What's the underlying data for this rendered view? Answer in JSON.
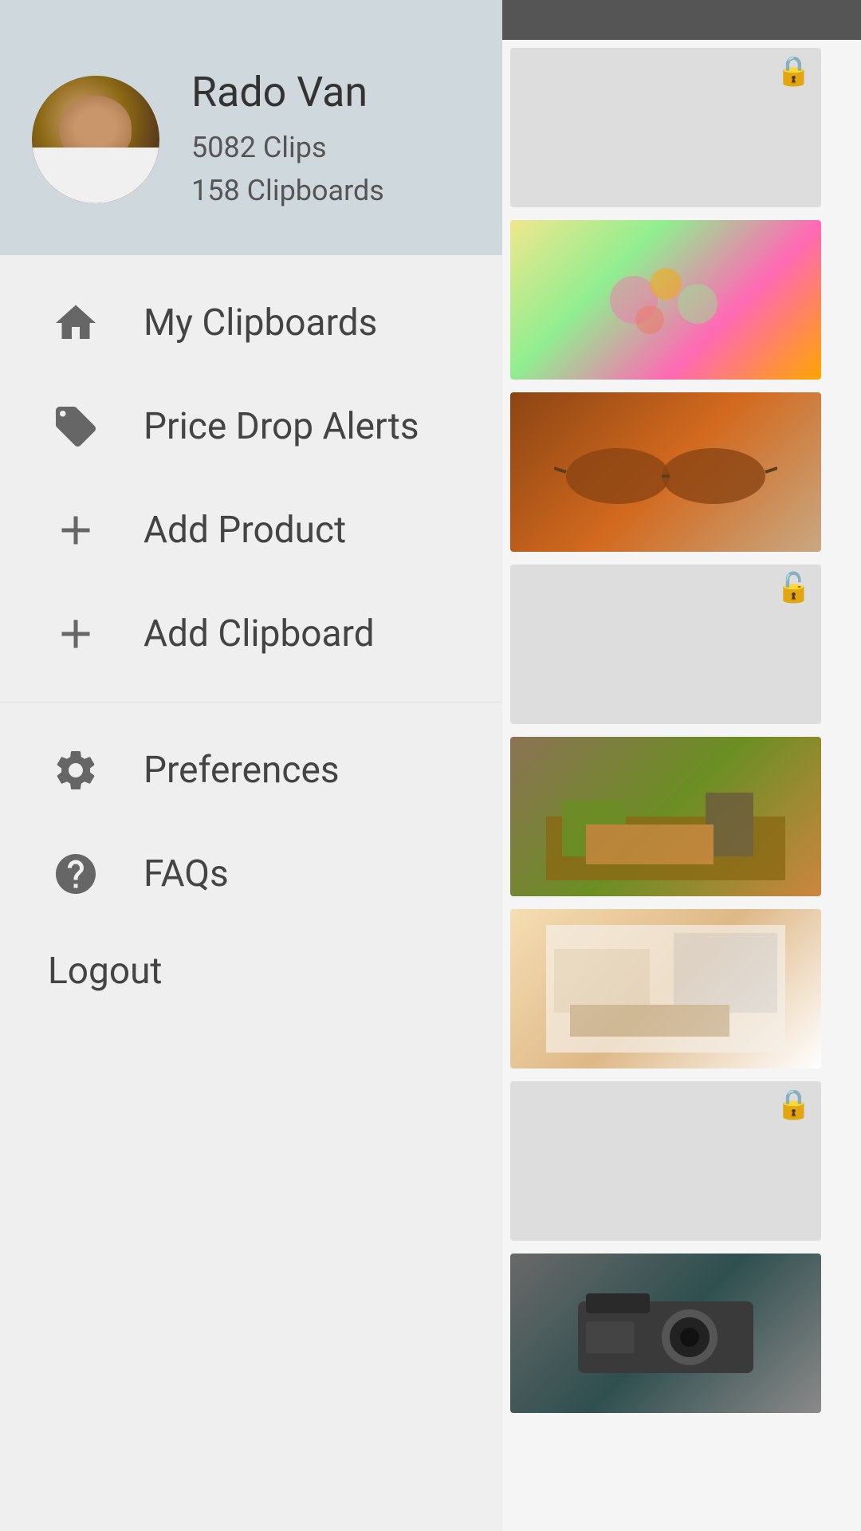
{
  "statusBar": {
    "height": 50
  },
  "header": {
    "chatIconLabel": "chat"
  },
  "profile": {
    "name": "Rado Van",
    "clips": "5082 Clips",
    "clipboards": "158 Clipboards"
  },
  "menu": {
    "topItems": [
      {
        "id": "my-clipboards",
        "label": "My Clipboards",
        "icon": "home"
      },
      {
        "id": "price-drop-alerts",
        "label": "Price Drop Alerts",
        "icon": "pricetag"
      },
      {
        "id": "add-product",
        "label": "Add Product",
        "icon": "plus"
      },
      {
        "id": "add-clipboard",
        "label": "Add Clipboard",
        "icon": "plus"
      }
    ],
    "bottomItems": [
      {
        "id": "preferences",
        "label": "Preferences",
        "icon": "gear"
      },
      {
        "id": "faqs",
        "label": "FAQs",
        "icon": "question"
      }
    ],
    "logoutLabel": "Logout"
  },
  "rightGrid": {
    "items": [
      {
        "id": "item1",
        "locked": false,
        "thumbType": "empty"
      },
      {
        "id": "item2",
        "locked": false,
        "thumbType": "floral"
      },
      {
        "id": "item3",
        "locked": false,
        "thumbType": "sunglasses"
      },
      {
        "id": "item4",
        "locked": true,
        "thumbType": "empty"
      },
      {
        "id": "item5",
        "locked": false,
        "thumbType": "bedroom1"
      },
      {
        "id": "item6",
        "locked": false,
        "thumbType": "bedroom2"
      },
      {
        "id": "item7",
        "locked": true,
        "thumbType": "empty"
      },
      {
        "id": "item8",
        "locked": false,
        "thumbType": "camera"
      }
    ]
  }
}
